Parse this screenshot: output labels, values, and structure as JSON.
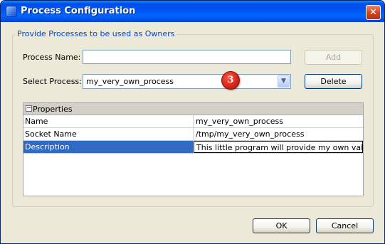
{
  "window": {
    "title": "Process Configuration",
    "close_glyph": "✕"
  },
  "group": {
    "legend": "Provide Processes to be used as Owners"
  },
  "form": {
    "process_name_label": "Process Name:",
    "process_name_value": "",
    "select_process_label": "Select Process:",
    "select_process_value": "my_very_own_process",
    "add_label": "Add",
    "delete_label": "Delete"
  },
  "badge": {
    "number": "3"
  },
  "properties": {
    "header": "Properties",
    "collapse_glyph": "−",
    "rows": [
      {
        "name": "Name",
        "value": "my_very_own_process"
      },
      {
        "name": "Socket Name",
        "value": "/tmp/my_very_own_process"
      },
      {
        "name": "Description",
        "value": "This little program will provide my own values"
      }
    ]
  },
  "footer": {
    "ok_label": "OK",
    "cancel_label": "Cancel"
  },
  "colors": {
    "titlebar": "#0053ee",
    "legend_text": "#0046d5",
    "selection": "#316ac5",
    "badge": "#d8271b"
  },
  "icons": {
    "window_icon": "app-icon",
    "close": "close-icon",
    "dropdown": "chevron-down-icon",
    "collapse": "minus-icon"
  }
}
